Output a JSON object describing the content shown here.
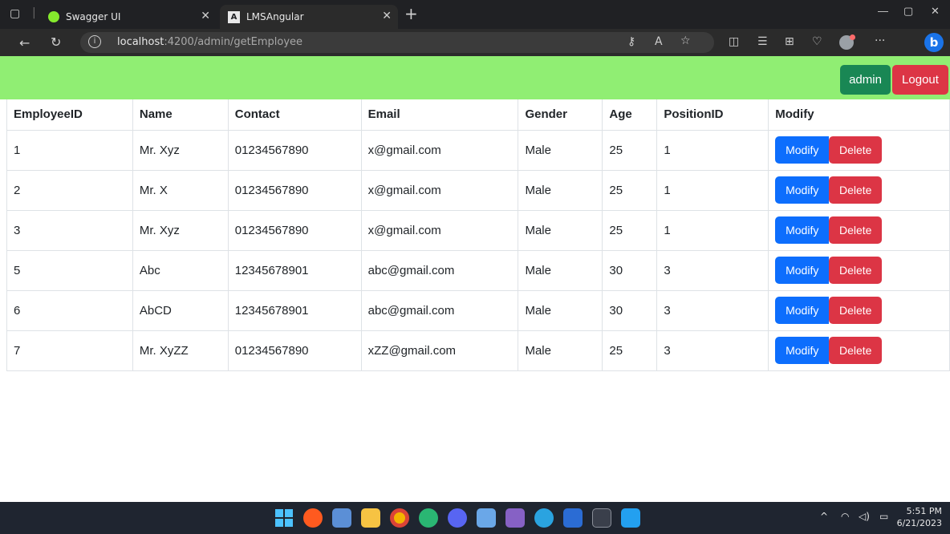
{
  "browser": {
    "tabs": [
      {
        "title": "Swagger UI",
        "icon": "swagger-icon"
      },
      {
        "title": "LMSAngular",
        "icon": "angular-icon"
      }
    ],
    "url_host": "localhost",
    "url_rest": ":4200/admin/getEmployee"
  },
  "navbar": {
    "admin_label": "admin",
    "logout_label": "Logout"
  },
  "table": {
    "headers": [
      "EmployeeID",
      "Name",
      "Contact",
      "Email",
      "Gender",
      "Age",
      "PositionID",
      "Modify"
    ],
    "rows": [
      {
        "id": "1",
        "name": "Mr. Xyz",
        "contact": "01234567890",
        "email": "x@gmail.com",
        "gender": "Male",
        "age": "25",
        "position": "1"
      },
      {
        "id": "2",
        "name": "Mr. X",
        "contact": "01234567890",
        "email": "x@gmail.com",
        "gender": "Male",
        "age": "25",
        "position": "1"
      },
      {
        "id": "3",
        "name": "Mr. Xyz",
        "contact": "01234567890",
        "email": "x@gmail.com",
        "gender": "Male",
        "age": "25",
        "position": "1"
      },
      {
        "id": "5",
        "name": "Abc",
        "contact": "12345678901",
        "email": "abc@gmail.com",
        "gender": "Male",
        "age": "30",
        "position": "3"
      },
      {
        "id": "6",
        "name": "AbCD",
        "contact": "12345678901",
        "email": "abc@gmail.com",
        "gender": "Male",
        "age": "30",
        "position": "3"
      },
      {
        "id": "7",
        "name": "Mr. XyZZ",
        "contact": "01234567890",
        "email": "xZZ@gmail.com",
        "gender": "Male",
        "age": "25",
        "position": "3"
      }
    ],
    "modify_label": "Modify",
    "delete_label": "Delete"
  },
  "taskbar": {
    "time": "5:51 PM",
    "date": "6/21/2023"
  },
  "colors": {
    "navbar": "#90ee73",
    "admin": "#198754",
    "danger": "#dc3545",
    "primary": "#0d6efd"
  }
}
